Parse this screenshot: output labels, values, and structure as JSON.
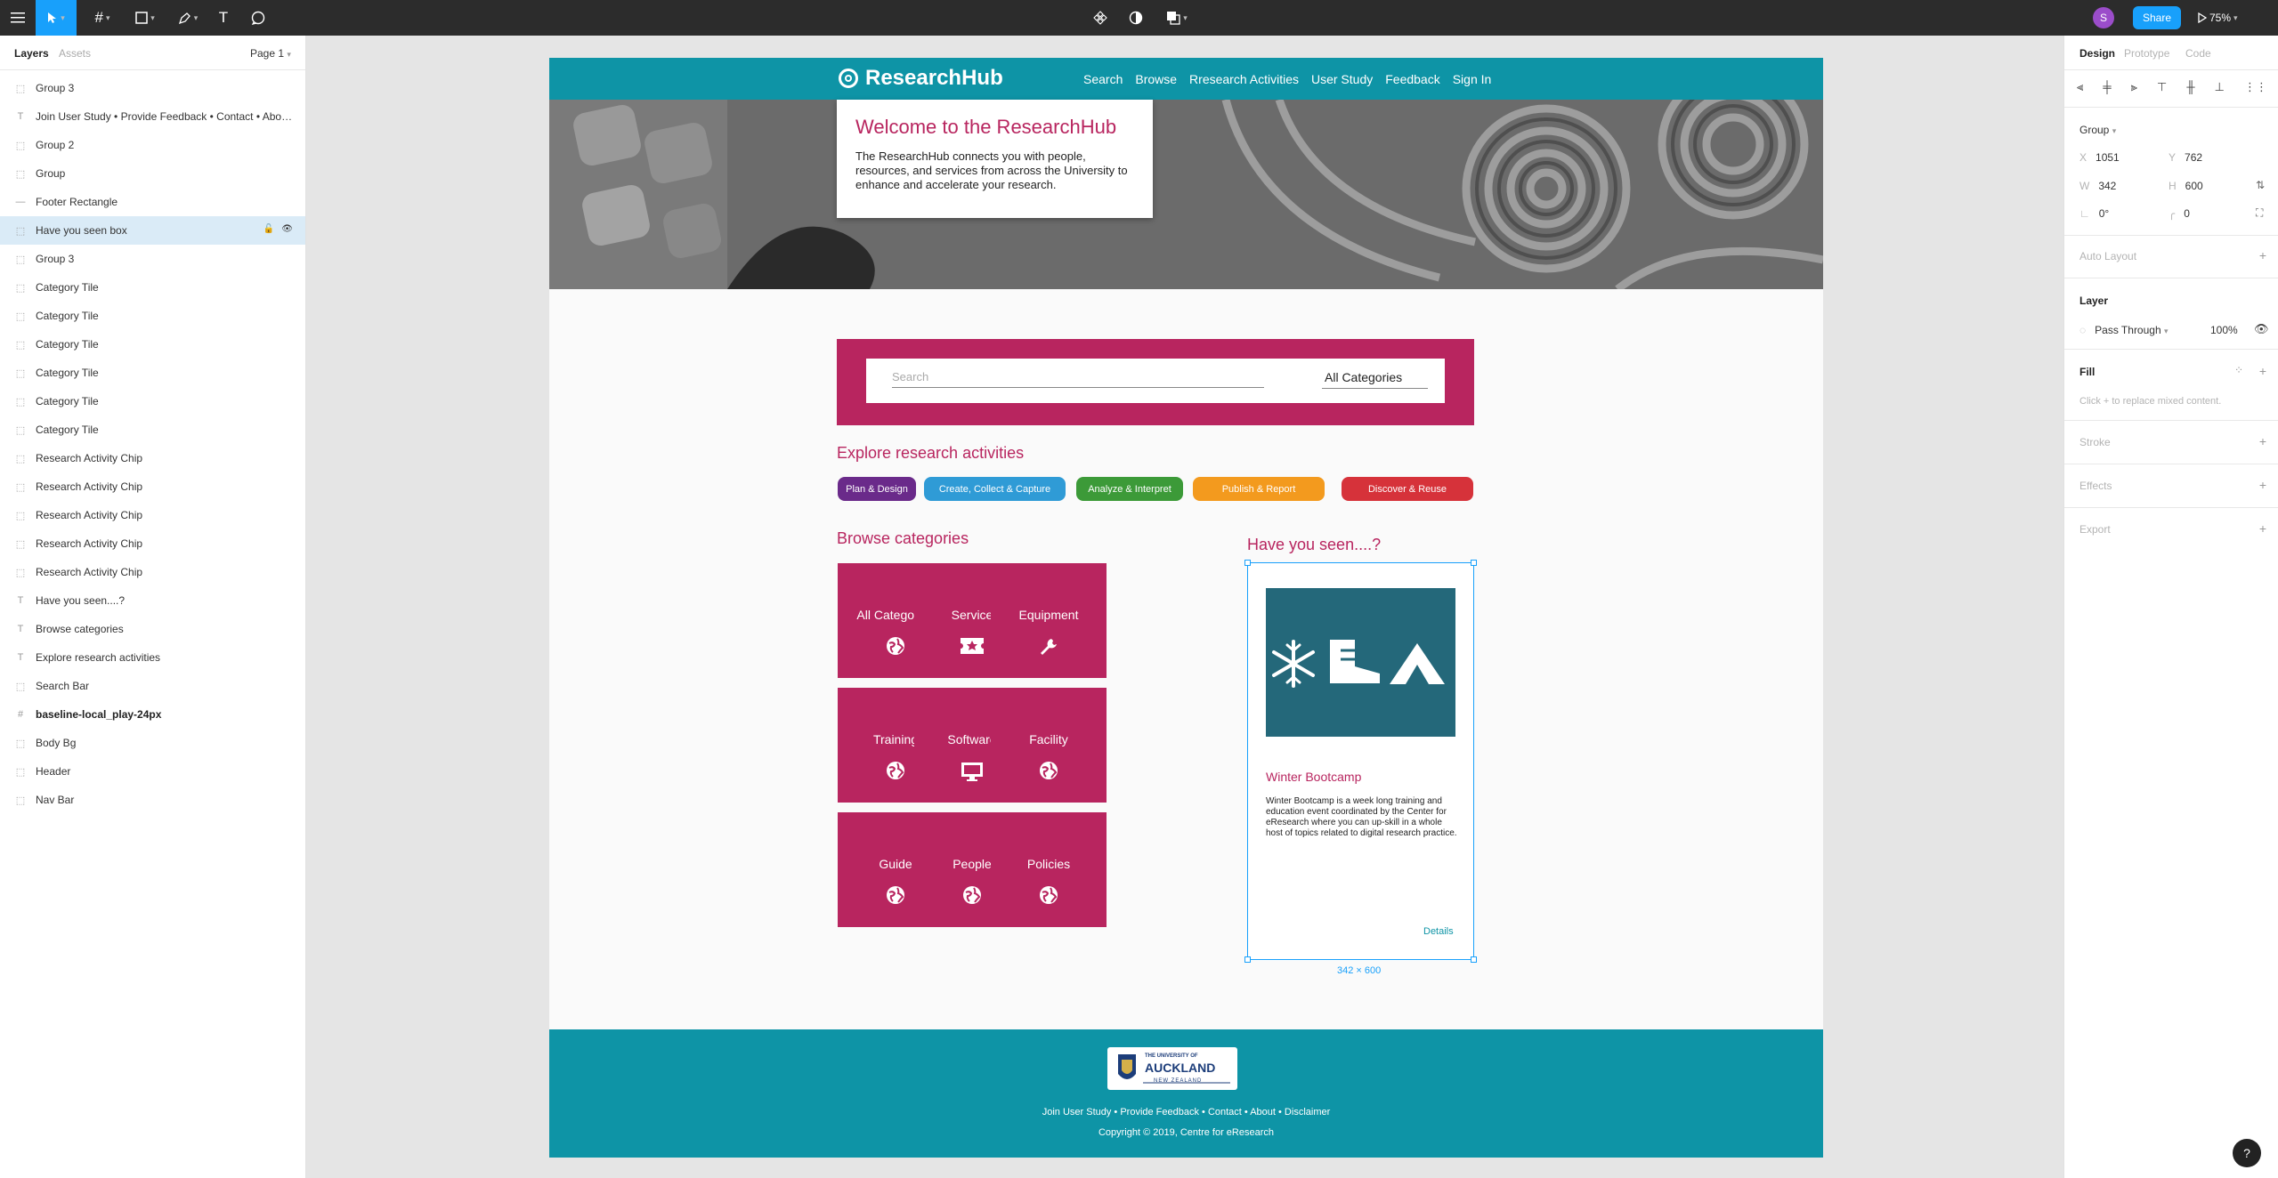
{
  "toolbar": {
    "share_label": "Share",
    "zoom_label": "75%",
    "avatar_initial": "S"
  },
  "left_panel": {
    "tabs": [
      "Layers",
      "Assets"
    ],
    "page_label": "Page 1",
    "layers": [
      {
        "name": "Group 3",
        "icon": "group-icon"
      },
      {
        "name": "Join User Study • Provide Feedback • Contact • About • Disclaimer",
        "icon": "text-icon"
      },
      {
        "name": "Group 2",
        "icon": "group-icon"
      },
      {
        "name": "Group",
        "icon": "group-icon"
      },
      {
        "name": "Footer Rectangle",
        "icon": "line-icon"
      },
      {
        "name": "Have you seen box",
        "icon": "group-icon",
        "selected": true
      },
      {
        "name": "Group 3",
        "icon": "group-icon"
      },
      {
        "name": "Category Tile",
        "icon": "group-icon"
      },
      {
        "name": "Category Tile",
        "icon": "group-icon"
      },
      {
        "name": "Category Tile",
        "icon": "group-icon"
      },
      {
        "name": "Category Tile",
        "icon": "group-icon"
      },
      {
        "name": "Category Tile",
        "icon": "group-icon"
      },
      {
        "name": "Category Tile",
        "icon": "group-icon"
      },
      {
        "name": "Research Activity Chip",
        "icon": "group-icon"
      },
      {
        "name": "Research Activity Chip",
        "icon": "group-icon"
      },
      {
        "name": "Research Activity Chip",
        "icon": "group-icon"
      },
      {
        "name": "Research Activity Chip",
        "icon": "group-icon"
      },
      {
        "name": "Research Activity Chip",
        "icon": "group-icon"
      },
      {
        "name": "Have you seen....?",
        "icon": "text-icon"
      },
      {
        "name": "Browse categories",
        "icon": "text-icon"
      },
      {
        "name": "Explore research activities",
        "icon": "text-icon"
      },
      {
        "name": "Search Bar",
        "icon": "group-icon"
      },
      {
        "name": "baseline-local_play-24px",
        "icon": "frame-icon",
        "bold": true
      },
      {
        "name": "Body Bg",
        "icon": "group-icon"
      },
      {
        "name": "Header",
        "icon": "group-icon"
      },
      {
        "name": "Nav Bar",
        "icon": "group-icon"
      }
    ]
  },
  "right_panel": {
    "tabs": [
      "Design",
      "Prototype",
      "Code"
    ],
    "selection_type": "Group",
    "x_label": "X",
    "x": "1051",
    "y_label": "Y",
    "y": "762",
    "w_label": "W",
    "w": "342",
    "h_label": "H",
    "h": "600",
    "rotation": "0°",
    "radius": "0",
    "auto_layout": "Auto Layout",
    "layer_heading": "Layer",
    "blend_mode": "Pass Through",
    "opacity": "100%",
    "fill_heading": "Fill",
    "fill_hint": "Click + to replace mixed content.",
    "stroke": "Stroke",
    "effects": "Effects",
    "export": "Export"
  },
  "canvas": {
    "selection_size_label": "342 × 600"
  },
  "site": {
    "logo_text": "ResearchHub",
    "nav": [
      "Search",
      "Browse",
      "Rresearch Activities",
      "User Study",
      "Feedback",
      "Sign In"
    ],
    "welcome_title": "Welcome to the ResearchHub",
    "welcome_text": "The ResearchHub connects you with people, resources, and services from across the University to enhance and accelerate your research.",
    "search_placeholder": "Search",
    "search_category": "All Categories",
    "explore_title": "Explore research activities",
    "chips": [
      {
        "label": "Plan & Design",
        "color": "#6a2a8a"
      },
      {
        "label": "Create, Collect & Capture",
        "color": "#2f9bd6"
      },
      {
        "label": "Analyze & Interpret",
        "color": "#3c9a38"
      },
      {
        "label": "Publish & Report",
        "color": "#f39a1e"
      },
      {
        "label": "Discover & Reuse",
        "color": "#d6323a"
      }
    ],
    "browse_title": "Browse categories",
    "categories": [
      {
        "label": "All Categories",
        "icon": "globe-icon"
      },
      {
        "label": "Service",
        "icon": "ticket-icon"
      },
      {
        "label": "Equipment",
        "icon": "wrench-icon"
      },
      {
        "label": "Training",
        "icon": "globe-icon"
      },
      {
        "label": "Software",
        "icon": "monitor-icon"
      },
      {
        "label": "Facility",
        "icon": "globe-icon"
      },
      {
        "label": "Guide",
        "icon": "globe-icon"
      },
      {
        "label": "People",
        "icon": "globe-icon"
      },
      {
        "label": "Policies",
        "icon": "globe-icon"
      }
    ],
    "seen_title": "Have you seen....?",
    "seen_card_title": "Winter Bootcamp",
    "seen_card_text": "Winter Bootcamp is a week long training and education event coordinated by the Center for eResearch where you can up-skill in a whole host of topics related to digital research practice.",
    "seen_card_link": "Details",
    "footer_logo_line1": "THE UNIVERSITY OF",
    "footer_logo_line2": "AUCKLAND",
    "footer_logo_line3": "NEW ZEALAND",
    "footer_links": "Join User Study • Provide Feedback • Contact • About • Disclaimer",
    "copyright": "Copyright © 2019, Centre for eResearch",
    "brand_colors": {
      "teal": "#0e94a6",
      "magenta": "#b8255f",
      "card_image": "#24687a"
    }
  }
}
